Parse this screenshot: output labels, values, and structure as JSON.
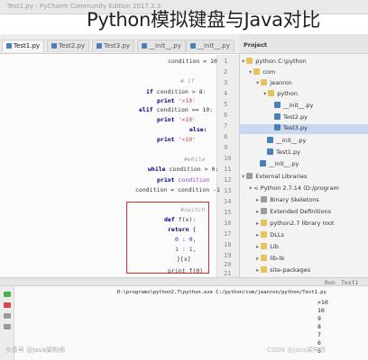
{
  "window": {
    "title": "Test1.py - PyCharm Community Edition 2017.2.3",
    "overlay_title": "Python模拟键盘与Java对比"
  },
  "tabs": [
    {
      "label": "Test1.py"
    },
    {
      "label": "Test2.py"
    },
    {
      "label": "Test3.py"
    },
    {
      "label": "__init__.py"
    },
    {
      "label": "__init__.py"
    }
  ],
  "project": {
    "header": "Project",
    "items": [
      {
        "label": "python  C:\\python"
      },
      {
        "label": "com"
      },
      {
        "label": "jeanron"
      },
      {
        "label": "python"
      },
      {
        "label": "__init__.py"
      },
      {
        "label": "Test2.py"
      },
      {
        "label": "Test3.py"
      },
      {
        "label": "__init__.py"
      },
      {
        "label": "Test1.py"
      },
      {
        "label": "__init__.py"
      },
      {
        "label": "External Libraries"
      },
      {
        "label": "< Python 2.7.14 (D:/program"
      },
      {
        "label": "Binary Skeletons"
      },
      {
        "label": "Extended Definitions"
      },
      {
        "label": "python2.7  library root"
      },
      {
        "label": "DLLs"
      },
      {
        "label": "Lib"
      },
      {
        "label": "lib-tk"
      },
      {
        "label": "site-packages"
      }
    ]
  },
  "editor": {
    "line_numbers": [
      "1",
      "2",
      "3",
      "4",
      "5",
      "6",
      "7",
      "8",
      "9",
      "10",
      "11",
      "12",
      "13",
      "14",
      "15",
      "16",
      "17",
      "18",
      "19",
      "20",
      "21"
    ],
    "code": {
      "l1": "condition = 10",
      "l2": "# if",
      "l3a": "if",
      "l3b": "condition > 8:",
      "l4a": "print",
      "l4b": "'>10'",
      "l5a": "elif",
      "l5b": "condition == 10:",
      "l6a": "print",
      "l6b": "'=10'",
      "l7": "else:",
      "l8a": "print",
      "l8b": "'<10'",
      "l9": "#while",
      "l10a": "while",
      "l10b": "condition > 0:",
      "l11a": "print",
      "l11b": "condition",
      "l12": "condition = condition -1",
      "l13": "#switch",
      "l14a": "def",
      "l14b": "f(x):",
      "l15a": "return",
      "l15b": "{",
      "l16": "0 : 0,",
      "l17": "1 : 1,",
      "l18": "}[x]",
      "l19": "print f(0)"
    }
  },
  "run": {
    "header": "Run",
    "tab": "Test1",
    "lines": [
      "D:\\programs\\python2.7\\python.exe C:/python/com/jeanron/python/Test1.py",
      ">10",
      "10",
      "9",
      "8",
      "7",
      "6",
      "5"
    ]
  },
  "watermarks": {
    "left": "头条号 @Java架构师",
    "right": "CSDN @Java架构师"
  }
}
